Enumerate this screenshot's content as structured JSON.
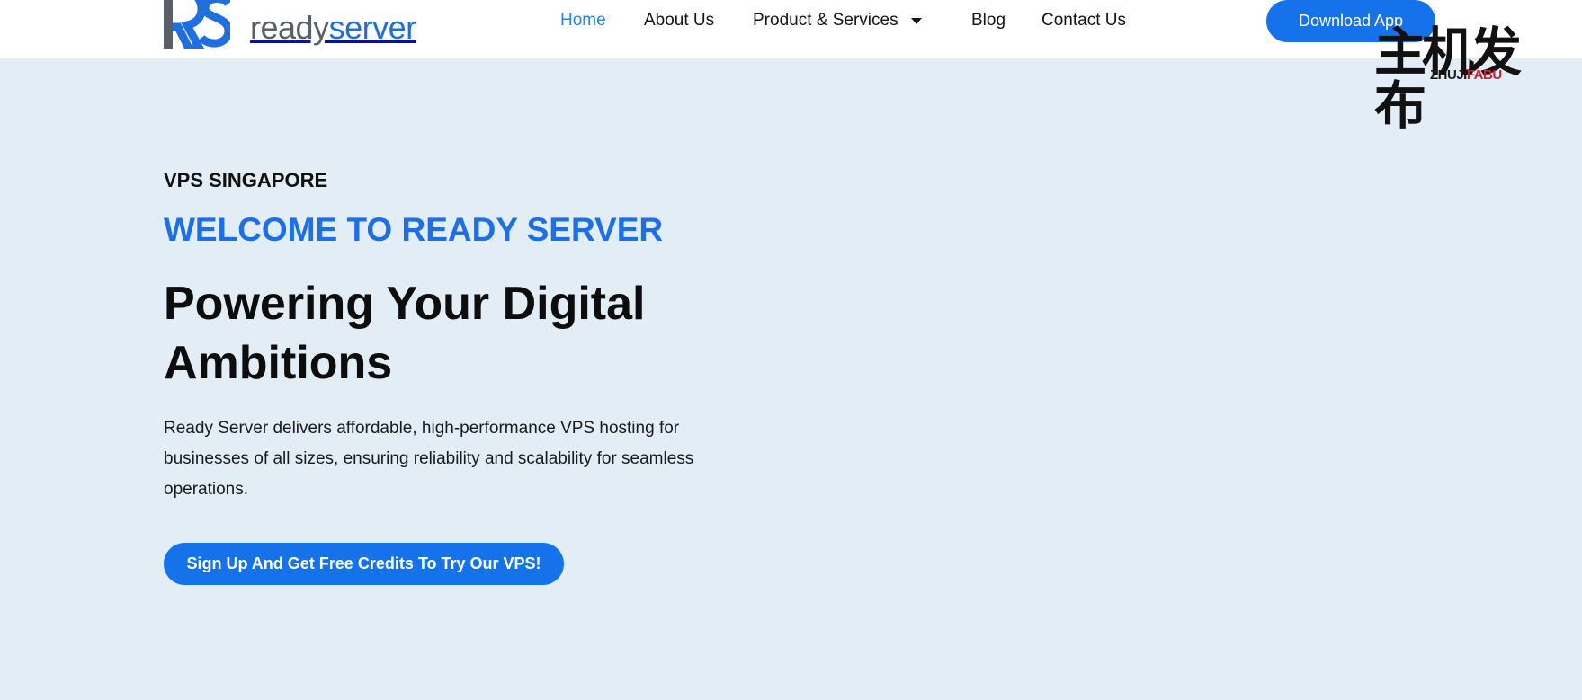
{
  "brand": {
    "word_ready": "ready",
    "word_server": "server"
  },
  "nav": {
    "items": [
      {
        "label": "Home",
        "active": true
      },
      {
        "label": "About Us",
        "active": false
      },
      {
        "label": "Product & Services",
        "active": false,
        "dropdown": true
      },
      {
        "label": "Blog",
        "active": false
      },
      {
        "label": "Contact Us",
        "active": false
      }
    ],
    "download_label": "Download App"
  },
  "watermark": {
    "chinese": "主机发布",
    "latin_a": "ZHUJI",
    "latin_b": "FABU"
  },
  "hero": {
    "eyebrow": "VPS SINGAPORE",
    "welcome": "WELCOME TO READY SERVER",
    "headline": "Powering Your Digital Ambitions",
    "description": "Ready Server delivers affordable, high-performance VPS hosting for businesses of all sizes, ensuring reliability and scalability for seamless operations.",
    "cta_label": "Sign Up And Get Free Credits To Try Our VPS!"
  },
  "colors": {
    "accent": "#1572ea",
    "nav_active": "#1e8ae0",
    "hero_bg": "#e2edf5",
    "logo_gray": "#5a5f66"
  },
  "icons": {
    "logo": "rs-logo-icon",
    "dropdown": "caret-down-icon"
  }
}
